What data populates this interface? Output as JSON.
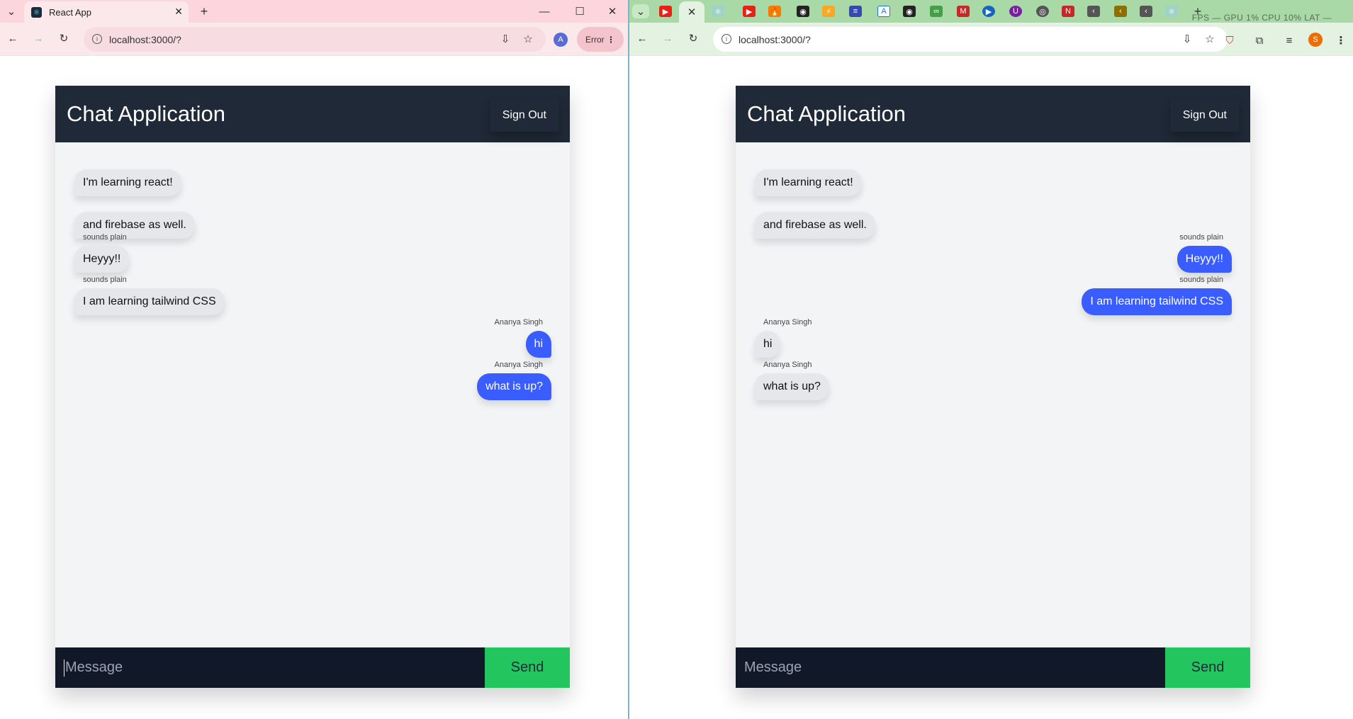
{
  "browser_left": {
    "tab_title": "React App",
    "url": "localhost:3000/?",
    "error_label": "Error",
    "profile_initial": "A"
  },
  "browser_right": {
    "url": "localhost:3000/?",
    "stats": "FPS — GPU 1% CPU 10% LAT —",
    "profile_initial": "S"
  },
  "app": {
    "title": "Chat Application",
    "sign_out_label": "Sign Out",
    "message_placeholder": "Message",
    "send_label": "Send"
  },
  "left_chat": {
    "messages": [
      {
        "name": "",
        "text": "I'm learning react!",
        "side": "received"
      },
      {
        "name": "",
        "text": "and firebase as well.",
        "side": "received"
      },
      {
        "name": "sounds plain",
        "text": "Heyyy!!",
        "side": "received"
      },
      {
        "name": "sounds plain",
        "text": "I am learning tailwind CSS",
        "side": "received"
      },
      {
        "name": "Ananya Singh",
        "text": "hi",
        "side": "sent"
      },
      {
        "name": "Ananya Singh",
        "text": "what is up?",
        "side": "sent"
      }
    ]
  },
  "right_chat": {
    "messages": [
      {
        "name": "",
        "text": "I'm learning react!",
        "side": "received"
      },
      {
        "name": "",
        "text": "and firebase as well.",
        "side": "received"
      },
      {
        "name": "sounds plain",
        "text": "Heyyy!!",
        "side": "sent"
      },
      {
        "name": "sounds plain",
        "text": "I am learning tailwind CSS",
        "side": "sent"
      },
      {
        "name": "Ananya Singh",
        "text": "hi",
        "side": "received"
      },
      {
        "name": "Ananya Singh",
        "text": "what is up?",
        "side": "received"
      }
    ]
  },
  "colors": {
    "header_bg": "#1f2937",
    "sent_bubble": "#395dff",
    "received_bubble": "#e5e7eb",
    "send_button": "#22c55e",
    "composer_bg": "#111827"
  }
}
